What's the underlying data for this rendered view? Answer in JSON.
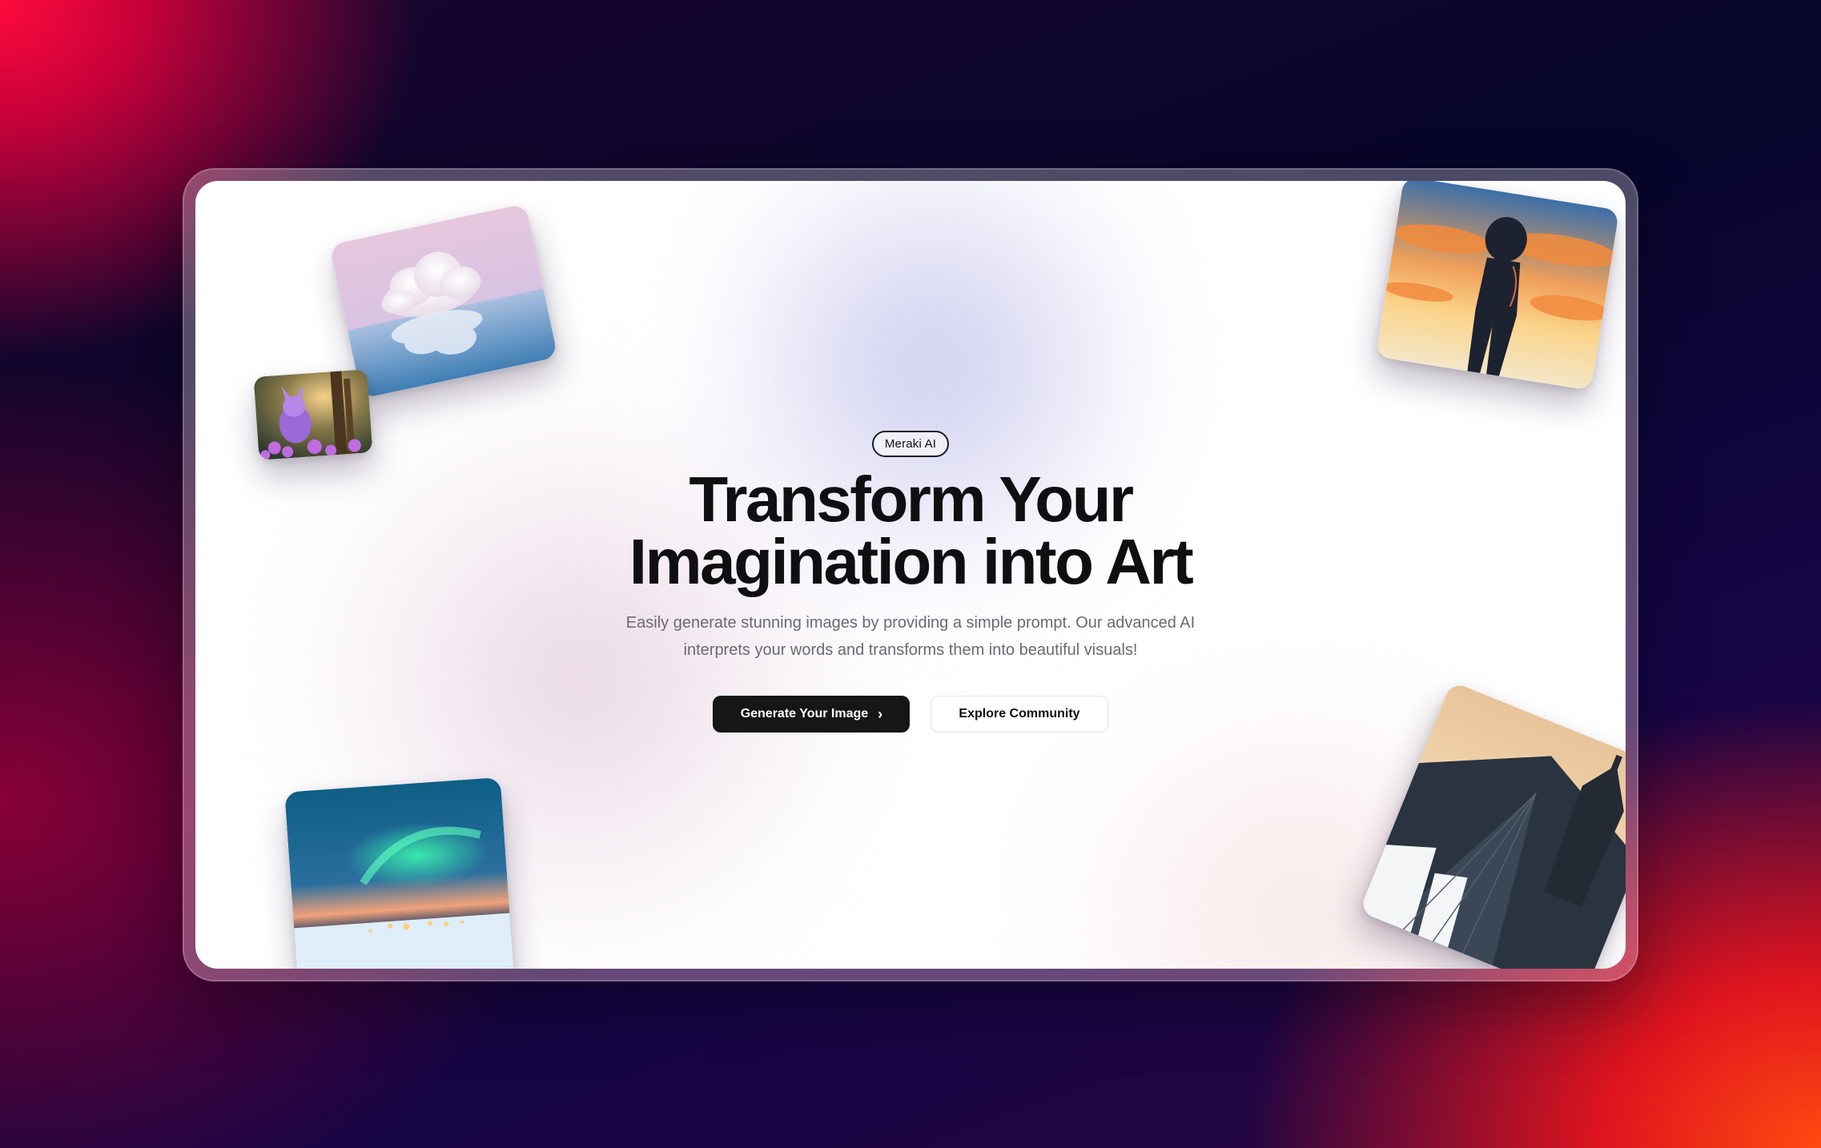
{
  "hero": {
    "badge": "Meraki AI",
    "title_line1": "Transform Your",
    "title_line2": "Imagination into Art",
    "subtitle": "Easily generate stunning images by providing a simple prompt. Our advanced AI interprets your words and transforms them into beautiful visuals!",
    "primary_button": "Generate Your Image",
    "secondary_button": "Explore Community",
    "primary_icon": "chevron-right-icon"
  },
  "gallery": [
    {
      "name": "cloud-reflection-image",
      "subject": "cloud"
    },
    {
      "name": "purple-creature-forest-image",
      "subject": "creature"
    },
    {
      "name": "astronaut-sunset-image",
      "subject": "astronaut"
    },
    {
      "name": "aurora-town-image",
      "subject": "aurora"
    },
    {
      "name": "snowy-castle-roof-image",
      "subject": "castle"
    }
  ],
  "colors": {
    "primary_button_bg": "#161616",
    "background_red": "#ff0a3c",
    "background_navy": "#06052a",
    "background_orange": "#ff4a10"
  }
}
